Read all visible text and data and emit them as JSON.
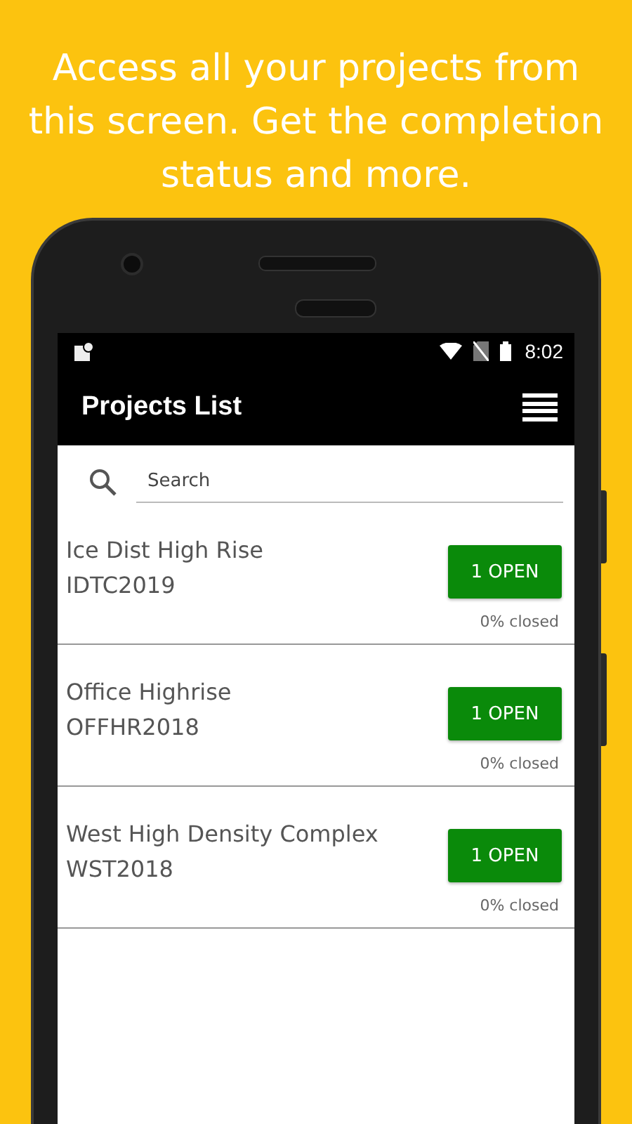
{
  "headline": "Access all your projects from this screen. Get the completion status and more.",
  "status_bar": {
    "time": "8:02"
  },
  "app_bar": {
    "title": "Projects List"
  },
  "search": {
    "placeholder": "Search"
  },
  "projects": [
    {
      "name": "Ice Dist High Rise",
      "code": "IDTC2019",
      "open_label": "1 OPEN",
      "closed_label": "0% closed"
    },
    {
      "name": "Office Highrise",
      "code": "OFFHR2018",
      "open_label": "1 OPEN",
      "closed_label": "0% closed"
    },
    {
      "name": "West High Density Complex",
      "code": "WST2018",
      "open_label": "1 OPEN",
      "closed_label": "0% closed"
    }
  ]
}
